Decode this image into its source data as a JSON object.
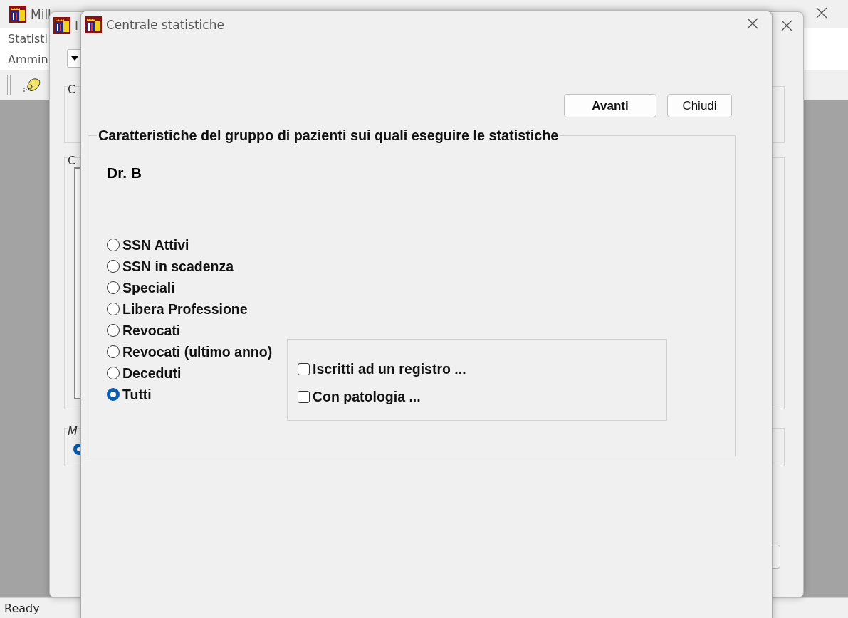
{
  "main_window": {
    "title": "Mill",
    "menu": [
      "Statisti",
      "Ammin"
    ],
    "status_bar": "Ready"
  },
  "middle_window": {
    "title": "I",
    "group_labels": [
      "C",
      "C",
      "M"
    ],
    "radio": {
      "selected": true
    }
  },
  "dialog": {
    "title": "Centrale statistiche",
    "buttons": [
      {
        "label": "Avanti",
        "default": true
      },
      {
        "label": "Chiudi",
        "default": false
      }
    ],
    "group": {
      "legend": "Caratteristiche del gruppo di pazienti sui quali eseguire le statistiche",
      "doctor": "Dr. B",
      "radios": [
        {
          "label": "SSN Attivi",
          "selected": false
        },
        {
          "label": "SSN in scadenza",
          "selected": false
        },
        {
          "label": "Speciali",
          "selected": false
        },
        {
          "label": "Libera Professione",
          "selected": false
        },
        {
          "label": "Revocati",
          "selected": false
        },
        {
          "label": "Revocati (ultimo anno)",
          "selected": false
        },
        {
          "label": "Deceduti",
          "selected": false
        },
        {
          "label": "Tutti",
          "selected": true
        }
      ],
      "checkboxes": [
        {
          "label": "Iscritti ad un registro ...",
          "checked": false
        },
        {
          "label": "Con patologia ...",
          "checked": false
        }
      ]
    }
  }
}
